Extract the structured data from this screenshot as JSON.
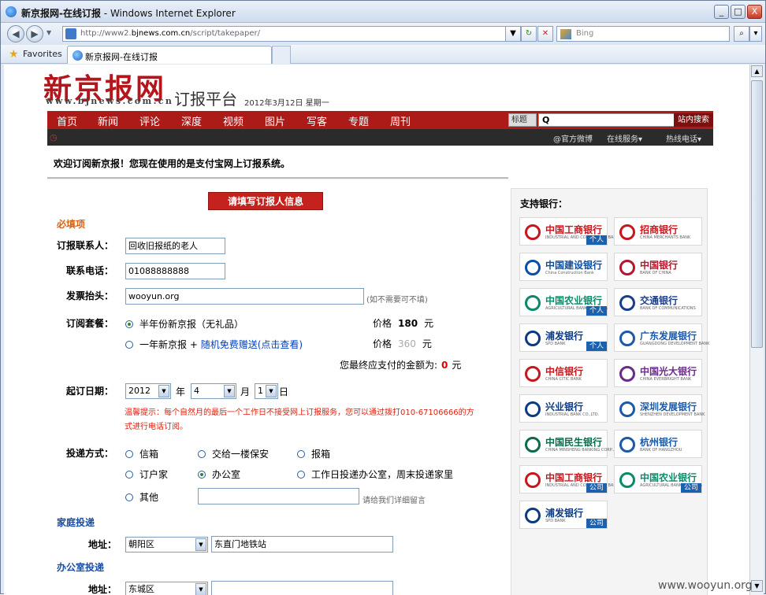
{
  "window": {
    "title": "新京报网-在线订报",
    "app_suffix": " - Windows Internet Explorer",
    "min_label": "_",
    "max_label": "□",
    "close_label": "X"
  },
  "addressbar": {
    "url_prefix": "http://www2.",
    "url_domain": "bjnews.com.cn",
    "url_path": "/script/takepaper/",
    "search_placeholder": "Bing"
  },
  "favorites": {
    "label": "Favorites",
    "tab_label": "新京报网-在线订报"
  },
  "header": {
    "logo": "新京报网",
    "logo_sub": "www.bjnews.com.cn",
    "platform": "订报平台",
    "date": "2012年3月12日 星期一"
  },
  "nav": {
    "items": [
      "首页",
      "新闻",
      "评论",
      "深度",
      "视频",
      "图片",
      "写客",
      "专题",
      "周刊"
    ],
    "search_type": "标题",
    "search_value": "Q",
    "search_button": "站内搜索"
  },
  "subnav": {
    "weibo": "@官方微博",
    "online": "在线服务▾",
    "hotline": "热线电话▾"
  },
  "welcome": "欢迎订阅新京报！您现在使用的是支付宝网上订报系统。",
  "form": {
    "section_button": "请填写订报人信息",
    "required": "必填项",
    "contact_label": "订报联系人：",
    "contact_value": "回收旧报纸的老人",
    "phone_label": "联系电话：",
    "phone_value": "01088888888",
    "invoice_label": "发票抬头：",
    "invoice_value": "wooyun.org",
    "invoice_hint": "(如不需要可不填)",
    "package_label": "订阅套餐：",
    "package1": "半年份新京报（无礼品）",
    "package2_prefix": "一年新京报 + ",
    "package2_link": "随机免费赠送(点击查看)",
    "price_label": "价格",
    "price1": "180",
    "price2": "360",
    "currency": "元",
    "total_prefix": "您最终应支付的金额为:",
    "total_value": "0",
    "total_unit": "元",
    "start_label": "起订日期：",
    "year": "2012",
    "year_unit": "年",
    "month": "4",
    "month_unit": "月",
    "day": "1",
    "day_unit": "日",
    "warning": "温馨提示：每个自然月的最后一个工作日不接受网上订报服务，您可以通过拨打010-67106666的方式进行电话订阅。",
    "delivery_label": "投递方式：",
    "delivery_options": [
      "信箱",
      "交给一楼保安",
      "报箱",
      "订户家",
      "办公室",
      "工作日投递办公室，周末投递家里",
      "其他"
    ],
    "other_hint": "请给我们详细留言",
    "home_section": "家庭投递",
    "address_label": "地址：",
    "home_district": "朝阳区",
    "home_address": "东直门地铁站",
    "office_section": "办公室投递",
    "office_district": "东城区"
  },
  "banks": {
    "title": "支持银行：",
    "items": [
      {
        "name": "中国工商银行",
        "en": "INDUSTRIAL AND COMMERCIAL BANK OF CHINA",
        "tag": "个人",
        "color": "#c8161d"
      },
      {
        "name": "招商银行",
        "en": "CHINA MERCHANTS BANK",
        "tag": "",
        "color": "#c8161d"
      },
      {
        "name": "中国建设银行",
        "en": "China Construction Bank",
        "tag": "",
        "color": "#0b4ea2"
      },
      {
        "name": "中国银行",
        "en": "BANK OF CHINA",
        "tag": "",
        "color": "#b8142a"
      },
      {
        "name": "中国农业银行",
        "en": "AGRICULTURAL BANK OF CHINA",
        "tag": "个人",
        "color": "#0a8a6a"
      },
      {
        "name": "交通银行",
        "en": "BANK OF COMMUNICATIONS",
        "tag": "",
        "color": "#1b3d8c"
      },
      {
        "name": "浦发银行",
        "en": "SPD BANK",
        "tag": "个人",
        "color": "#0b3a82"
      },
      {
        "name": "广东发展银行",
        "en": "GUANGDONG DEVELOPMENT BANK",
        "tag": "",
        "color": "#1b5aa8"
      },
      {
        "name": "中信银行",
        "en": "CHINA CITIC BANK",
        "tag": "",
        "color": "#c8161d"
      },
      {
        "name": "中国光大银行",
        "en": "CHINA EVERBRIGHT BANK",
        "tag": "",
        "color": "#6a2a8a"
      },
      {
        "name": "兴业银行",
        "en": "INDUSTRIAL BANK CO.,LTD.",
        "tag": "",
        "color": "#0b3a82"
      },
      {
        "name": "深圳发展银行",
        "en": "SHENZHEN DEVELOPMENT BANK",
        "tag": "",
        "color": "#1b5aa8"
      },
      {
        "name": "中国民生银行",
        "en": "CHINA MINSHENG BANKING CORP.,LTD.",
        "tag": "",
        "color": "#0a6a4a"
      },
      {
        "name": "杭州银行",
        "en": "BANK OF HANGZHOU",
        "tag": "",
        "color": "#1b5aa8"
      },
      {
        "name": "中国工商银行",
        "en": "INDUSTRIAL AND COMMERCIAL BANK OF CHINA",
        "tag": "公司",
        "color": "#c8161d"
      },
      {
        "name": "中国农业银行",
        "en": "AGRICULTURAL BANK OF CHINA",
        "tag": "公司",
        "color": "#0a8a6a"
      },
      {
        "name": "浦发银行",
        "en": "SPD BANK",
        "tag": "公司",
        "color": "#0b3a82"
      }
    ]
  },
  "watermark": "www.wooyun.org"
}
